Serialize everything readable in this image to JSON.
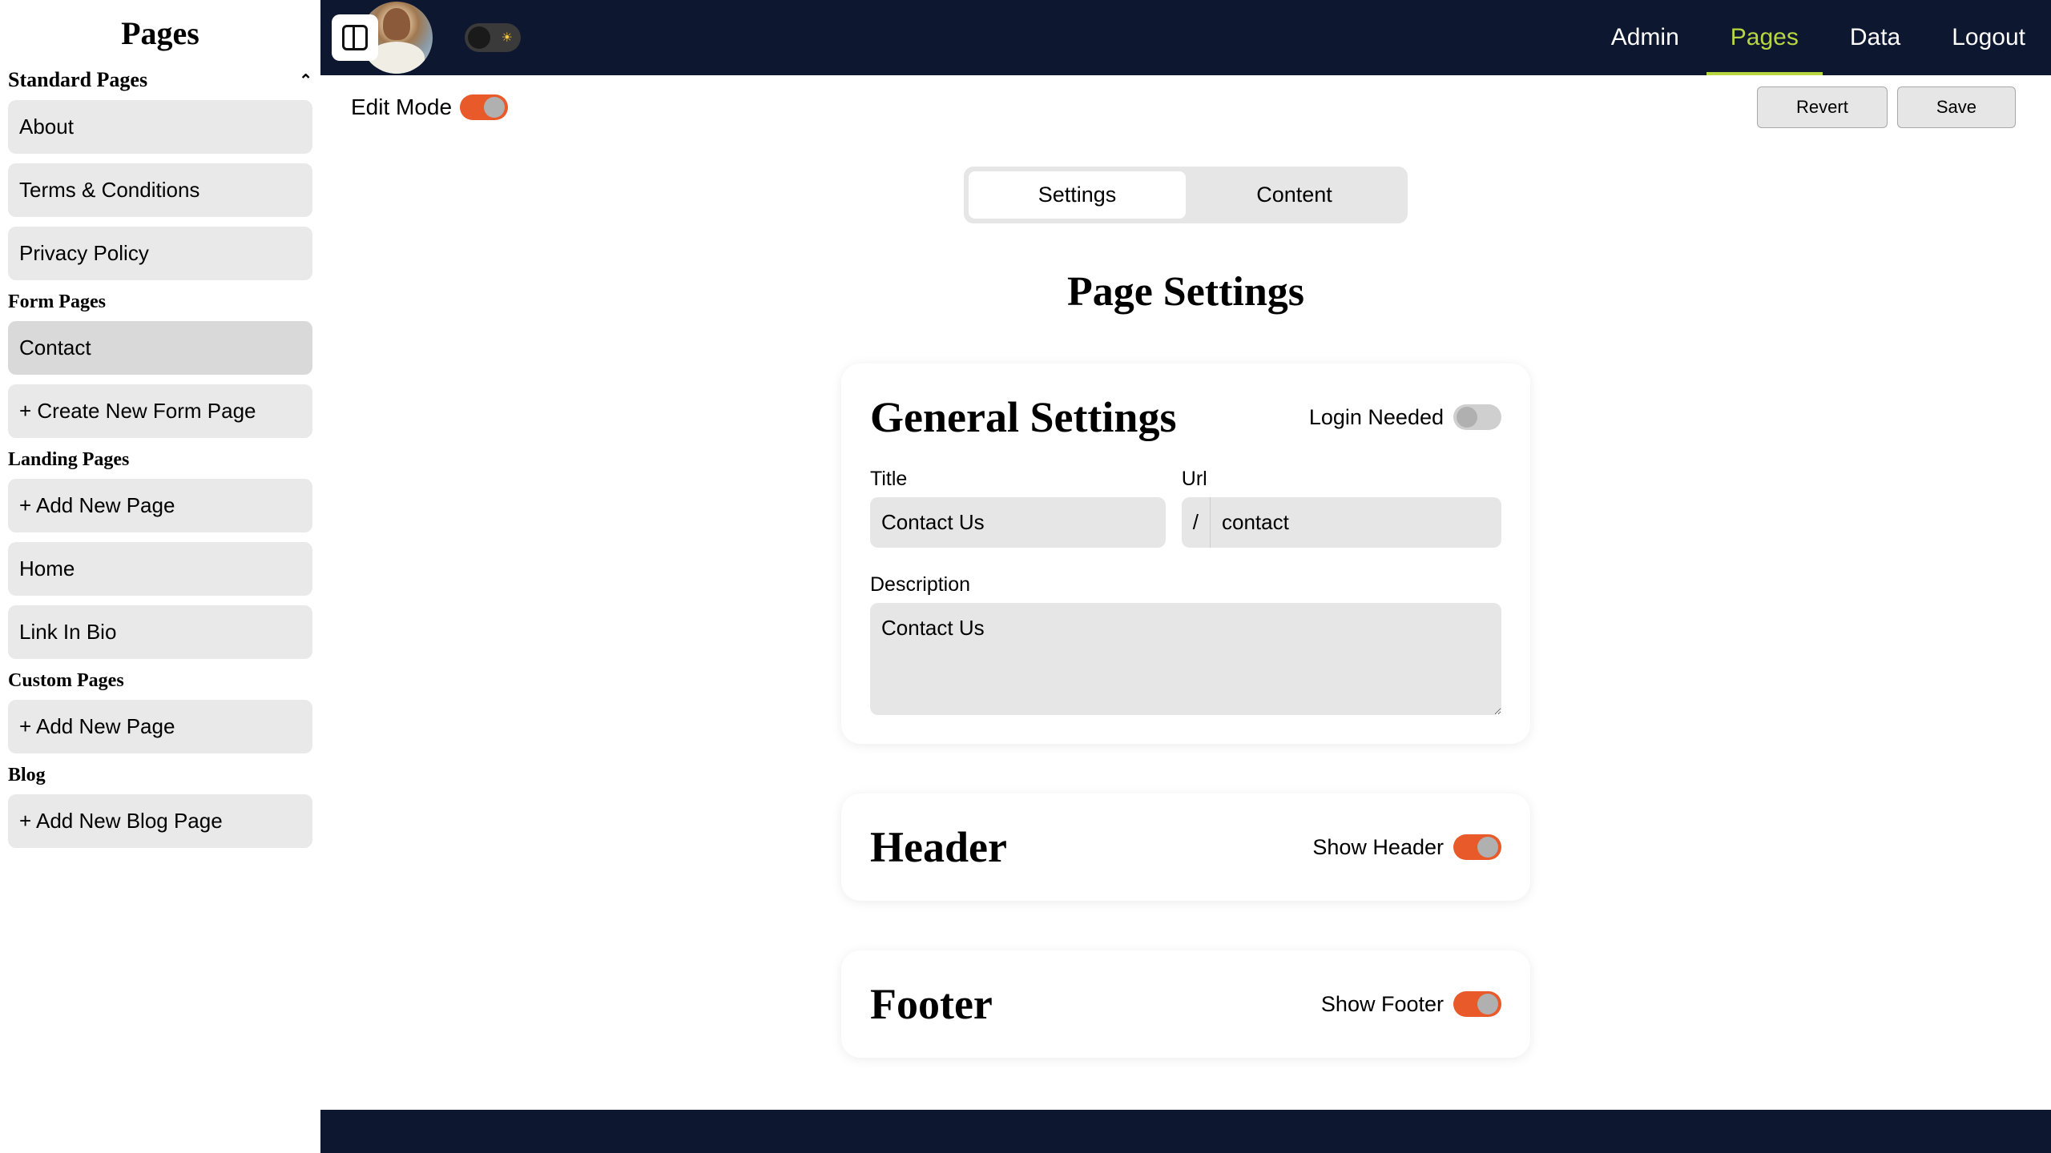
{
  "sidebar": {
    "title": "Pages",
    "sections": {
      "standard": {
        "label": "Standard Pages",
        "items": [
          "About",
          "Terms & Conditions",
          "Privacy Policy"
        ]
      },
      "form": {
        "label": "Form Pages",
        "items": [
          "Contact",
          "+ Create New Form Page"
        ]
      },
      "landing": {
        "label": "Landing Pages",
        "items": [
          "+ Add New Page",
          "Home",
          "Link In Bio"
        ]
      },
      "custom": {
        "label": "Custom Pages",
        "items": [
          "+ Add New Page"
        ]
      },
      "blog": {
        "label": "Blog",
        "items": [
          "+ Add New Blog Page"
        ]
      }
    }
  },
  "nav": {
    "admin": "Admin",
    "pages": "Pages",
    "data": "Data",
    "logout": "Logout"
  },
  "editbar": {
    "edit_mode_label": "Edit Mode",
    "revert": "Revert",
    "save": "Save"
  },
  "tabs": {
    "settings": "Settings",
    "content": "Content"
  },
  "heading": "Page Settings",
  "general": {
    "card_title": "General Settings",
    "login_label": "Login Needed",
    "title_label": "Title",
    "title_value": "Contact Us",
    "url_label": "Url",
    "url_prefix": "/",
    "url_value": "contact",
    "desc_label": "Description",
    "desc_value": "Contact Us"
  },
  "header_card": {
    "title": "Header",
    "toggle_label": "Show Header"
  },
  "footer_card": {
    "title": "Footer",
    "toggle_label": "Show Footer"
  }
}
